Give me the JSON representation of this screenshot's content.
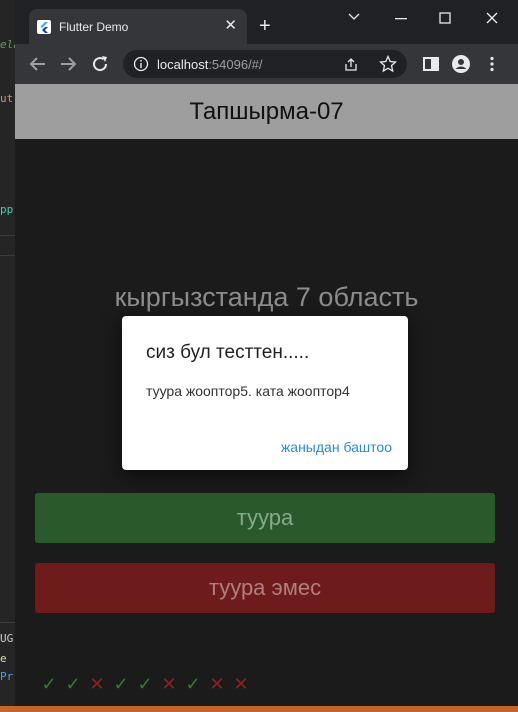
{
  "browser": {
    "tab_title": "Flutter Demo",
    "url_host": "localhost",
    "url_rest": ":54096/#/"
  },
  "editor_bg": {
    "fragments": [
      "ela",
      "ut",
      "pp",
      "UG",
      "e",
      "Pr"
    ]
  },
  "app": {
    "title": "Тапшырма-07",
    "question": "кыргызстанда 7 область",
    "true_button": "туура",
    "false_button": "туура эмес",
    "score_marks": [
      "✓",
      "✓",
      "✕",
      "✓",
      "✓",
      "✕",
      "✓",
      "✕",
      "✕"
    ]
  },
  "dialog": {
    "title": "сиз бул тесттен.....",
    "body": "туура жооптор5. ката жооптор4",
    "action": "жаныдан баштоо"
  },
  "colors": {
    "accent": "#2a8bd4",
    "true_button": "#2a5a2c",
    "false_button": "#6e1b1b",
    "appbar": "#9e9e9e"
  }
}
